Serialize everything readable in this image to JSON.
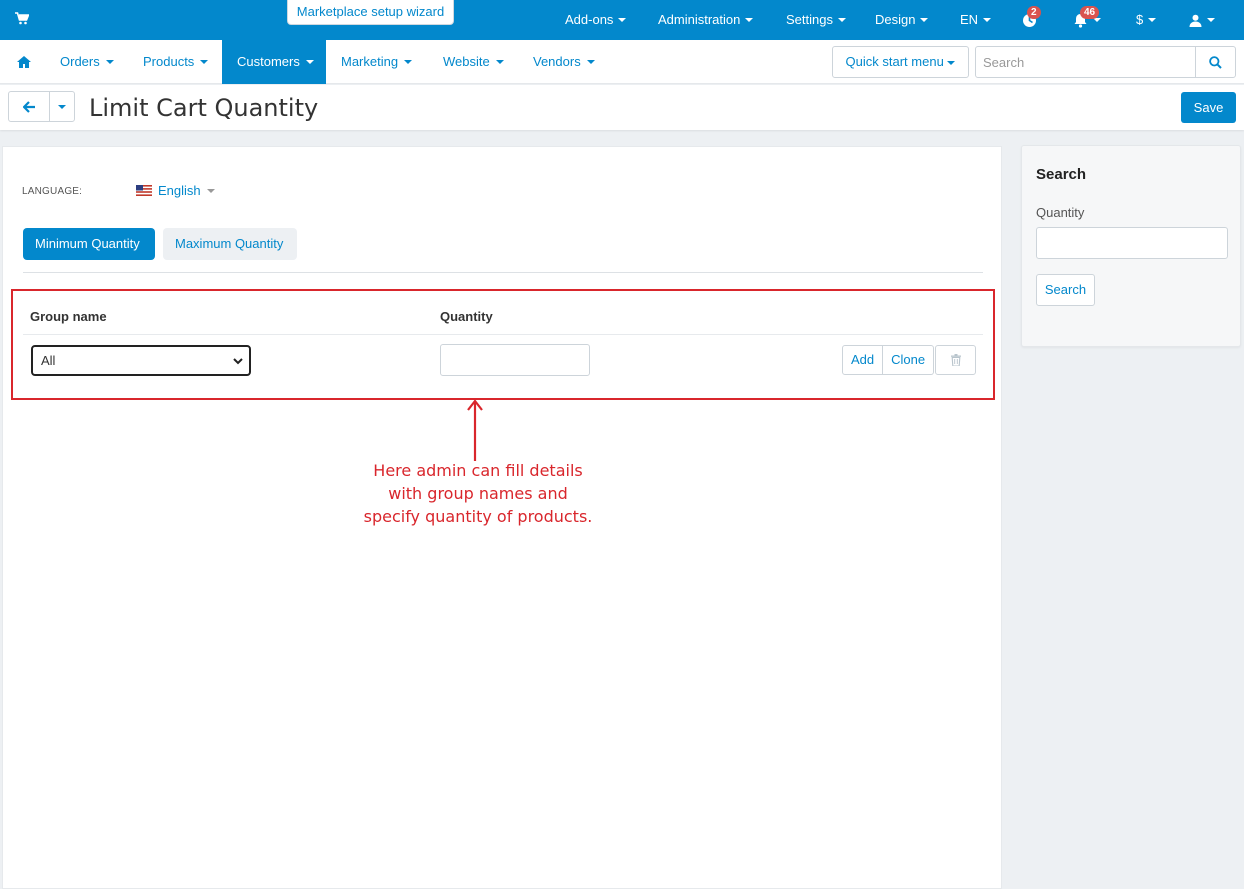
{
  "topbar": {
    "wizard_label": "Marketplace setup wizard",
    "menu": [
      {
        "label": "Add-ons"
      },
      {
        "label": "Administration"
      },
      {
        "label": "Settings"
      },
      {
        "label": "Design"
      },
      {
        "label": "EN"
      }
    ],
    "notifications": {
      "updates_count": "2",
      "bell_count": "46"
    },
    "currency": "$",
    "colors": {
      "primary": "#0388cc",
      "badge": "#d9534f"
    }
  },
  "nav": {
    "items": [
      {
        "label": "Orders"
      },
      {
        "label": "Products"
      },
      {
        "label": "Customers",
        "active": true
      },
      {
        "label": "Marketing"
      },
      {
        "label": "Website"
      },
      {
        "label": "Vendors"
      }
    ],
    "quick_start": "Quick start menu",
    "search_placeholder": "Search"
  },
  "header": {
    "title": "Limit Cart Quantity",
    "save_label": "Save"
  },
  "main": {
    "language_label": "LANGUAGE:",
    "language_value": "English",
    "tabs": [
      {
        "label": "Minimum Quantity",
        "active": true
      },
      {
        "label": "Maximum Quantity",
        "active": false
      }
    ],
    "table": {
      "columns": [
        "Group name",
        "Quantity"
      ],
      "row": {
        "group_value": "All",
        "quantity_value": "",
        "add_label": "Add",
        "clone_label": "Clone"
      }
    },
    "annotation": "Here admin can fill details with  group names and specify quantity of products.",
    "annotation_color": "#d9262c"
  },
  "sidebar": {
    "title": "Search",
    "quantity_label": "Quantity",
    "search_button": "Search"
  }
}
